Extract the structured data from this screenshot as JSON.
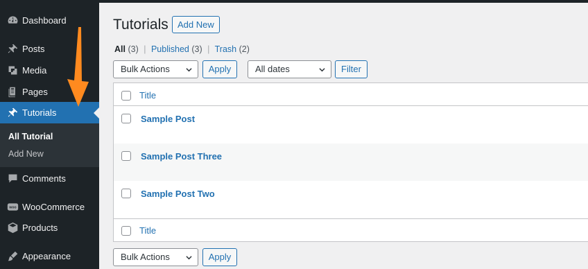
{
  "sidebar": {
    "items": [
      {
        "label": "Dashboard",
        "icon": "dashboard-icon"
      },
      {
        "label": "Posts",
        "icon": "pin-icon"
      },
      {
        "label": "Media",
        "icon": "media-icon"
      },
      {
        "label": "Pages",
        "icon": "pages-icon"
      },
      {
        "label": "Tutorials",
        "icon": "pin-icon",
        "active": true
      },
      {
        "label": "Comments",
        "icon": "comment-icon"
      },
      {
        "label": "WooCommerce",
        "icon": "woo-icon"
      },
      {
        "label": "Products",
        "icon": "products-icon"
      },
      {
        "label": "Appearance",
        "icon": "appearance-icon"
      }
    ],
    "submenu": [
      {
        "label": "All Tutorial",
        "current": true
      },
      {
        "label": "Add New"
      }
    ]
  },
  "header": {
    "title": "Tutorials",
    "add_new": "Add New"
  },
  "views": {
    "all_label": "All",
    "all_count": "(3)",
    "published_label": "Published",
    "published_count": "(3)",
    "trash_label": "Trash",
    "trash_count": "(2)",
    "separator": "|"
  },
  "filters": {
    "bulk_actions": "Bulk Actions",
    "apply": "Apply",
    "dates": "All dates",
    "filter": "Filter"
  },
  "table": {
    "column_title": "Title",
    "rows": [
      {
        "title": "Sample Post"
      },
      {
        "title": "Sample Post Three"
      },
      {
        "title": "Sample Post Two"
      }
    ]
  },
  "colors": {
    "accent": "#2271b1",
    "sidebar_bg": "#1d2327",
    "annotation_arrow": "#ff8a1f"
  }
}
